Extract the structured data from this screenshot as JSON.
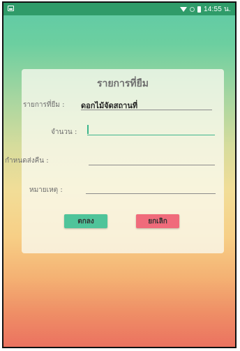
{
  "status_bar": {
    "time": "14:55 น.",
    "icons": [
      "image-notification-icon",
      "wifi-icon",
      "no-signal-icon",
      "battery-icon"
    ]
  },
  "dialog": {
    "title": "รายการที่ยืม",
    "fields": [
      {
        "label": "รายการที่ยืม :",
        "value": "ดอกไม้จัดสถานที่"
      },
      {
        "label": "จำนวน :",
        "value": ""
      },
      {
        "label": "กำหนดส่งคืน :",
        "value": ""
      },
      {
        "label": "หมายเหตุ :",
        "value": ""
      }
    ],
    "ok_label": "ตกลง",
    "cancel_label": "ยกเลิก"
  },
  "colors": {
    "status_bar": "#2f9b69",
    "ok_button": "#4fc49a",
    "cancel_button": "#f06b7b",
    "focus_accent": "#3cb58c"
  }
}
